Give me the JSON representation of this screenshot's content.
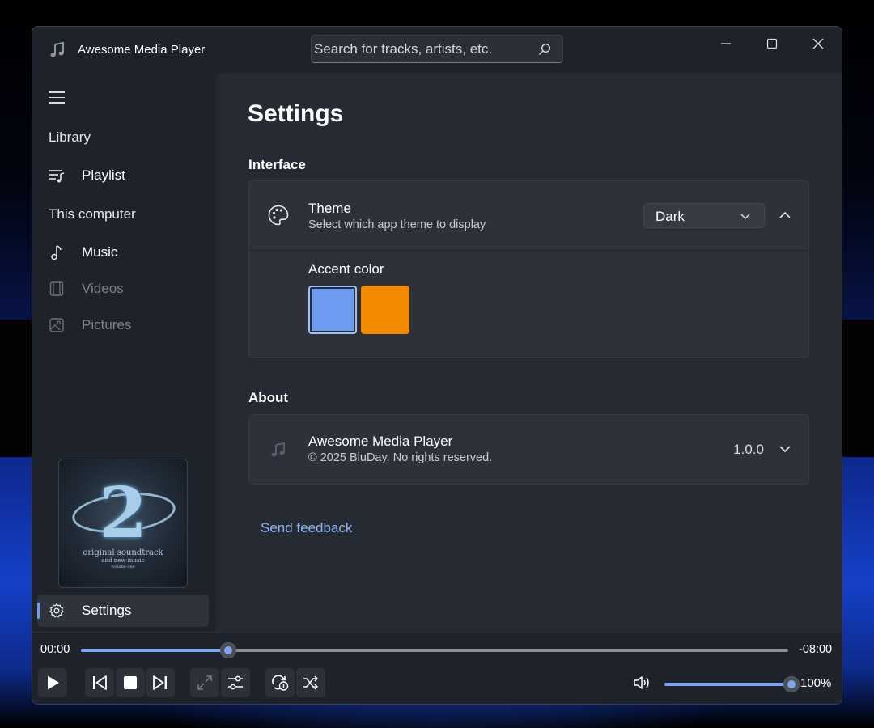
{
  "app": {
    "title": "Awesome Media Player",
    "icon": "music-note-icon"
  },
  "search": {
    "placeholder": "Search for tracks, artists, etc.",
    "value": ""
  },
  "window_controls": [
    "minimize-icon",
    "maximize-icon",
    "close-icon"
  ],
  "sidebar": {
    "sections": {
      "library": "Library",
      "this_computer": "This computer"
    },
    "items": [
      {
        "label": "Playlist",
        "icon": "playlist-icon",
        "enabled": true
      },
      {
        "label": "Music",
        "icon": "music-note-icon",
        "enabled": true
      },
      {
        "label": "Videos",
        "icon": "film-icon",
        "enabled": false
      },
      {
        "label": "Pictures",
        "icon": "image-icon",
        "enabled": false
      }
    ],
    "album_art": {
      "text_line1": "original soundtrack",
      "text_line2": "and new music",
      "text_line3": "volume one"
    },
    "settings": {
      "label": "Settings",
      "icon": "gear-icon",
      "selected": true
    }
  },
  "settings_page": {
    "title": "Settings",
    "interface": {
      "heading": "Interface",
      "theme": {
        "title": "Theme",
        "description": "Select which app theme to display",
        "selected": "Dark",
        "expanded": true
      },
      "accent": {
        "title": "Accent color",
        "colors": [
          "#6d9bf0",
          "#f38a00"
        ],
        "selected_index": 0
      }
    },
    "about": {
      "heading": "About",
      "app_name": "Awesome Media Player",
      "copyright": "© 2025 BluDay. No rights reserved.",
      "version": "1.0.0",
      "expanded": false
    },
    "feedback_link": "Send feedback"
  },
  "player": {
    "elapsed": "00:00",
    "remaining": "-08:00",
    "progress_fraction": 0.208,
    "volume_label": "100%",
    "volume_fraction": 1.0,
    "accent_color": "#7ea5f0"
  }
}
